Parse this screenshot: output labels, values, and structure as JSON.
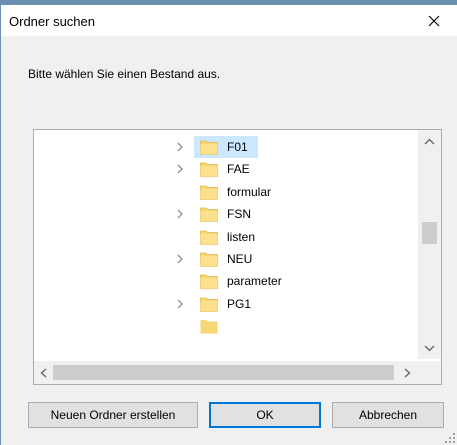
{
  "window": {
    "title": "Ordner suchen",
    "close_icon": "close-icon"
  },
  "prompt_text": "Bitte wählen Sie einen Bestand aus.",
  "tree": {
    "items": [
      {
        "label": "F01",
        "expandable": true,
        "selected": true
      },
      {
        "label": "FAE",
        "expandable": true,
        "selected": false
      },
      {
        "label": "formular",
        "expandable": false,
        "selected": false
      },
      {
        "label": "FSN",
        "expandable": true,
        "selected": false
      },
      {
        "label": "listen",
        "expandable": false,
        "selected": false
      },
      {
        "label": "NEU",
        "expandable": true,
        "selected": false
      },
      {
        "label": "parameter",
        "expandable": false,
        "selected": false
      },
      {
        "label": "PG1",
        "expandable": true,
        "selected": false
      }
    ],
    "selection_color": "#cce8ff",
    "folder_color": "#f8d775"
  },
  "buttons": {
    "new_folder": "Neuen Ordner erstellen",
    "ok": "OK",
    "cancel": "Abbrechen"
  },
  "colors": {
    "accent": "#0078d7",
    "dialog_bg": "#f0f0f0"
  }
}
